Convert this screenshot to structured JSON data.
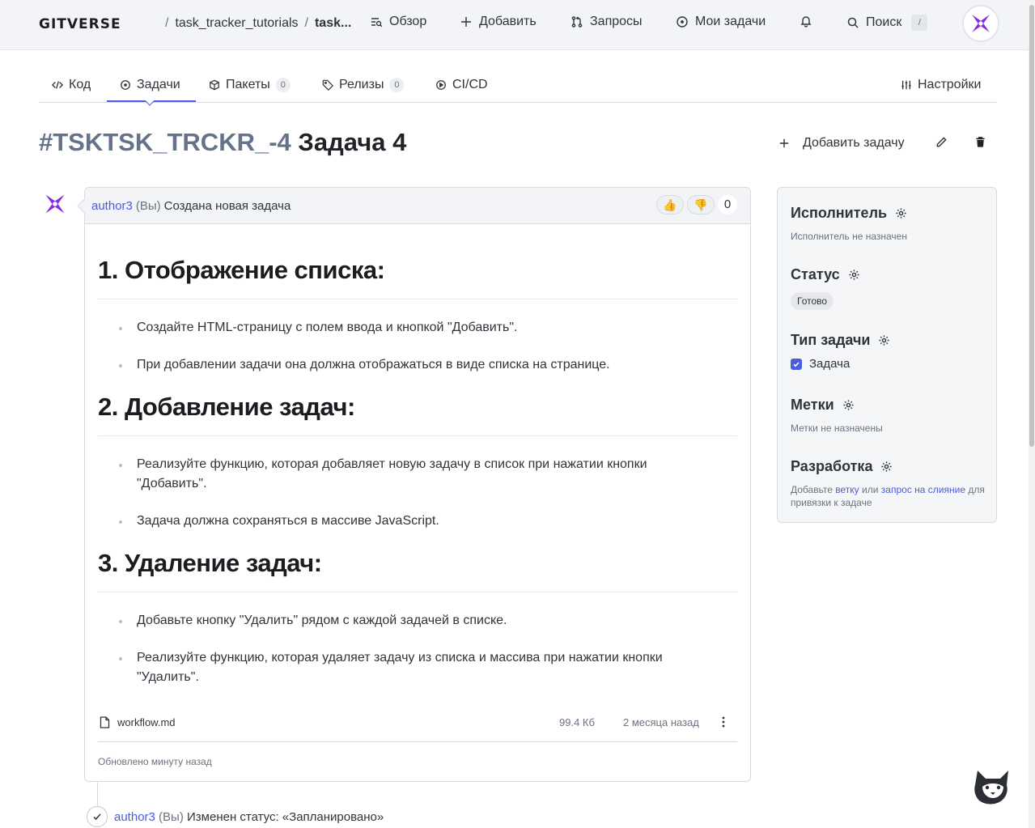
{
  "header": {
    "logo": "GITVERSE",
    "breadcrumb": {
      "repo": "task_tracker_tutorials",
      "current": "task..."
    },
    "nav": {
      "overview": "Обзор",
      "add": "Добавить",
      "requests": "Запросы",
      "my_tasks": "Мои задачи",
      "search": "Поиск",
      "search_shortcut": "/"
    }
  },
  "tabs": {
    "code": "Код",
    "tasks": "Задачи",
    "packages": "Пакеты",
    "packages_count": "0",
    "releases": "Релизы",
    "releases_count": "0",
    "cicd": "CI/CD",
    "settings": "Настройки"
  },
  "issue": {
    "number": "#TSKTSK_TRCKR_-4",
    "title": "Задача 4",
    "add_task": "Добавить задачу"
  },
  "comment": {
    "author": "author3",
    "you": "(Вы)",
    "action": "Создана новая задача",
    "reactions": {
      "up": "👍",
      "down": "👎",
      "count": "0"
    },
    "sections": [
      {
        "heading": "1. Отображение списка:",
        "items": [
          "Создайте HTML-страницу с полем ввода и кнопкой \"Добавить\".",
          "При добавлении задачи она должна отображаться в виде списка на странице."
        ]
      },
      {
        "heading": "2. Добавление задач:",
        "items": [
          "Реализуйте функцию, которая добавляет новую задачу в список при нажатии кнопки \"Добавить\".",
          "Задача должна сохраняться в массиве JavaScript."
        ]
      },
      {
        "heading": "3. Удаление задач:",
        "items": [
          "Добавьте кнопку \"Удалить\" рядом с каждой задачей в списке.",
          "Реализуйте функцию, которая удаляет задачу из списка и массива при нажатии кнопки \"Удалить\"."
        ]
      }
    ],
    "attachment": {
      "name": "workflow.md",
      "size": "99.4 Кб",
      "date": "2 месяца назад"
    },
    "updated": "Обновлено минуту назад"
  },
  "event": {
    "author": "author3",
    "you": "(Вы)",
    "text": "Изменен статус: «Запланировано»"
  },
  "sidebar": {
    "assignee_title": "Исполнитель",
    "assignee_value": "Исполнитель не назначен",
    "status_title": "Статус",
    "status_value": "Готово",
    "type_title": "Тип задачи",
    "type_value": "Задача",
    "labels_title": "Метки",
    "labels_value": "Метки не назначены",
    "dev_title": "Разработка",
    "dev_text_1": "Добавьте",
    "dev_link_branch": "ветку",
    "dev_text_or": "или",
    "dev_link_pr": "запрос на слияние",
    "dev_text_2": "для привязки к задаче"
  },
  "colors": {
    "accent": "#4a5ce0",
    "brand_purple": "#8a2be2"
  }
}
